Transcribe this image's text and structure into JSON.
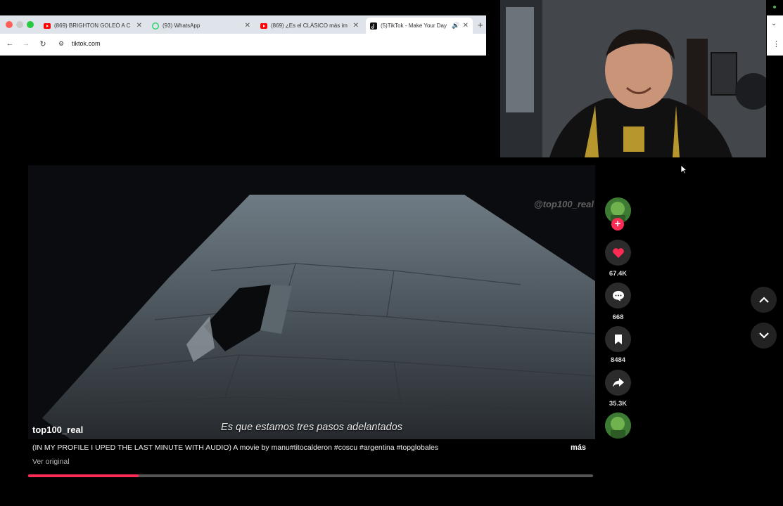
{
  "browser": {
    "tabs": [
      {
        "title": "(869) BRIGHTON GOLEÓ A C",
        "icon": "youtube-icon"
      },
      {
        "title": "(93) WhatsApp",
        "icon": "whatsapp-icon"
      },
      {
        "title": "(869) ¿Es el CLÁSICO más im",
        "icon": "youtube-icon"
      },
      {
        "title": "(5)TikTok - Make Your Day",
        "icon": "tiktok-icon",
        "active": true
      }
    ],
    "url": "tiktok.com"
  },
  "video": {
    "watermark": "@top100_real",
    "subtitle": "Es que estamos tres pasos adelantados",
    "username": "top100_real",
    "caption": "(IN MY PROFILE I UPED THE LAST MINUTE WITH AUDIO) A movie by manu#titocalderon #coscu #argentina #topglobales",
    "more_label": "más",
    "translate_label": "Ver original",
    "progress_fraction": 0.195
  },
  "actions": {
    "likes": "67.4K",
    "comments": "668",
    "saves": "8484",
    "shares": "35.3K"
  },
  "colors": {
    "accent": "#fe2c55"
  }
}
